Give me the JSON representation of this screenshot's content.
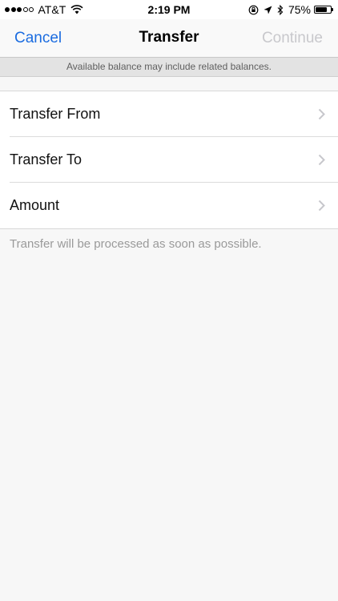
{
  "status_bar": {
    "carrier": "AT&T",
    "time": "2:19 PM",
    "battery_percent": "75%",
    "battery_level": 0.75,
    "signal_bars": 3,
    "signal_total": 5
  },
  "nav": {
    "cancel_label": "Cancel",
    "title": "Transfer",
    "continue_label": "Continue"
  },
  "info_banner": "Available balance may include related balances.",
  "rows": [
    {
      "label": "Transfer From"
    },
    {
      "label": "Transfer To"
    },
    {
      "label": "Amount"
    }
  ],
  "footer_note": "Transfer will be processed as soon as possible.",
  "colors": {
    "accent": "#1b6ce0",
    "disabled": "#c8c8cc",
    "background": "#f7f7f7"
  }
}
